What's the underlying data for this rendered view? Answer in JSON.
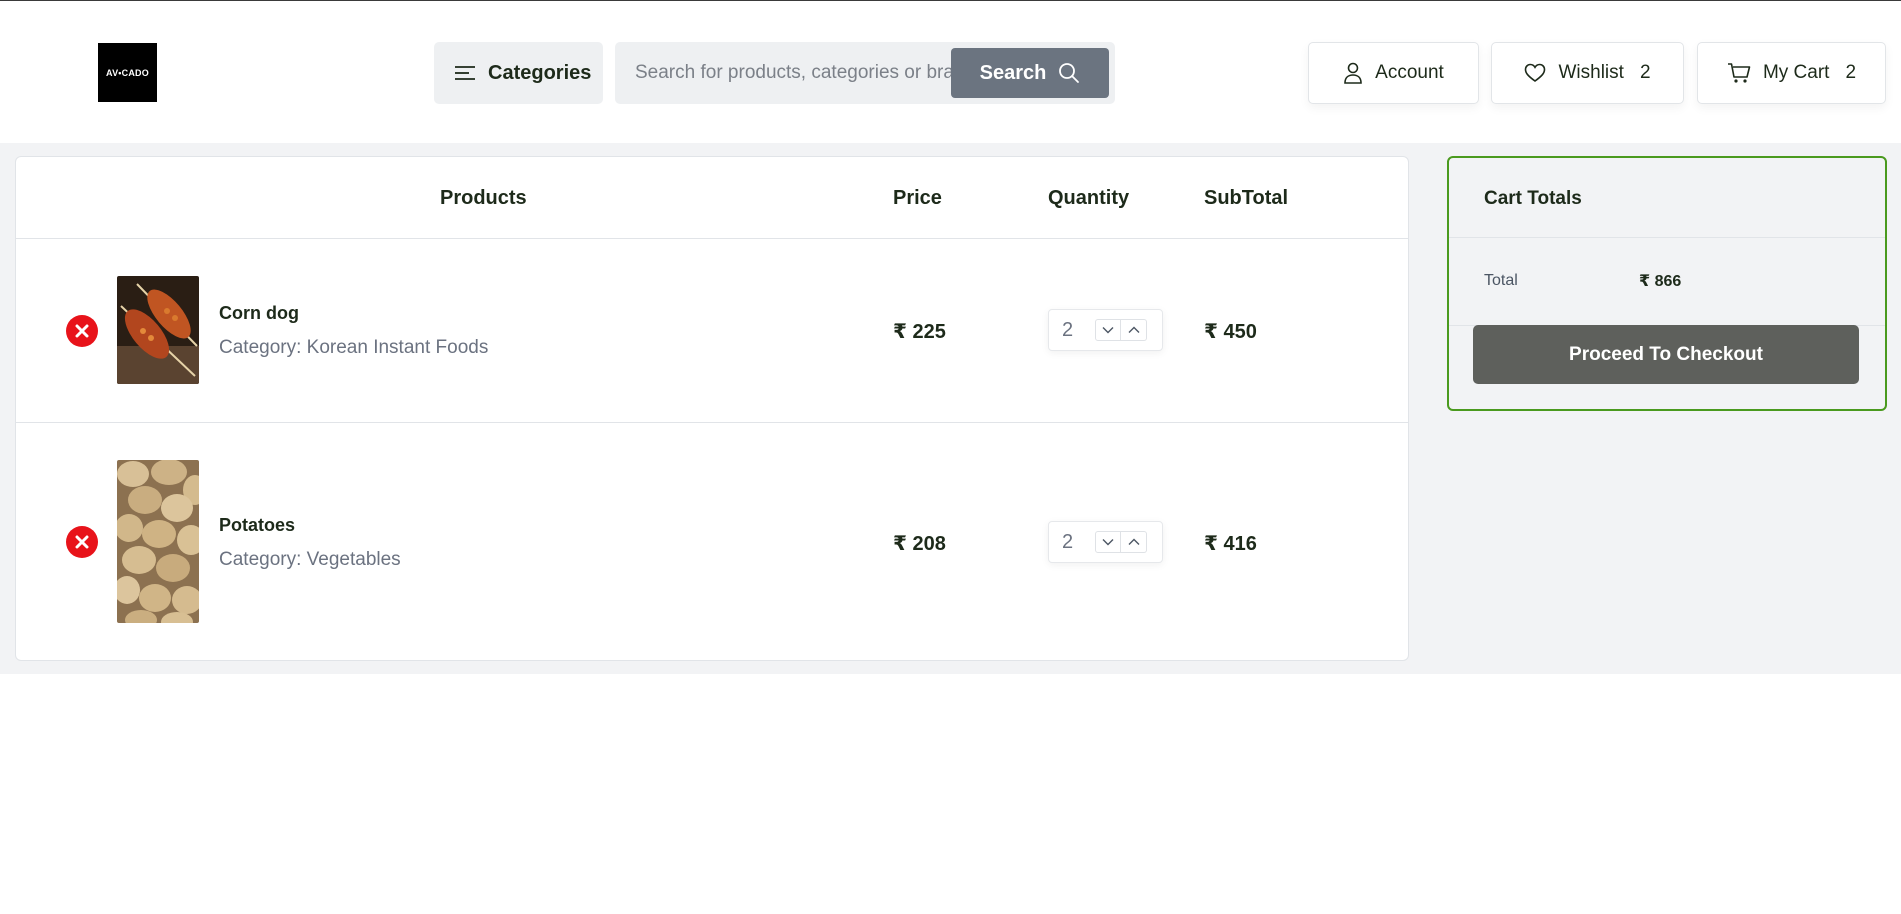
{
  "header": {
    "logo_text": "AV•CADO",
    "categories_label": "Categories",
    "search": {
      "placeholder": "Search for products, categories or brands",
      "button_label": "Search"
    },
    "account_label": "Account",
    "wishlist_label": "Wishlist",
    "wishlist_count": "2",
    "cart_label": "My Cart",
    "cart_count": "2"
  },
  "table": {
    "headers": {
      "products": "Products",
      "price": "Price",
      "quantity": "Quantity",
      "subtotal": "SubTotal"
    },
    "rows": [
      {
        "name": "Corn dog",
        "category": "Category: Korean Instant Foods",
        "price": "₹ 225",
        "quantity": "2",
        "subtotal": "₹ 450",
        "image_icon": "corn-dog-image"
      },
      {
        "name": "Potatoes",
        "category": "Category: Vegetables",
        "price": "₹ 208",
        "quantity": "2",
        "subtotal": "₹ 416",
        "image_icon": "potatoes-image"
      }
    ]
  },
  "totals": {
    "title": "Cart Totals",
    "total_label": "Total",
    "total_value": "₹ 866",
    "checkout_label": "Proceed To Checkout"
  },
  "colors": {
    "accent_border": "#4a9a1e",
    "remove_red": "#e8131a",
    "search_button": "#6b7480",
    "checkout_button": "#5e605c"
  }
}
